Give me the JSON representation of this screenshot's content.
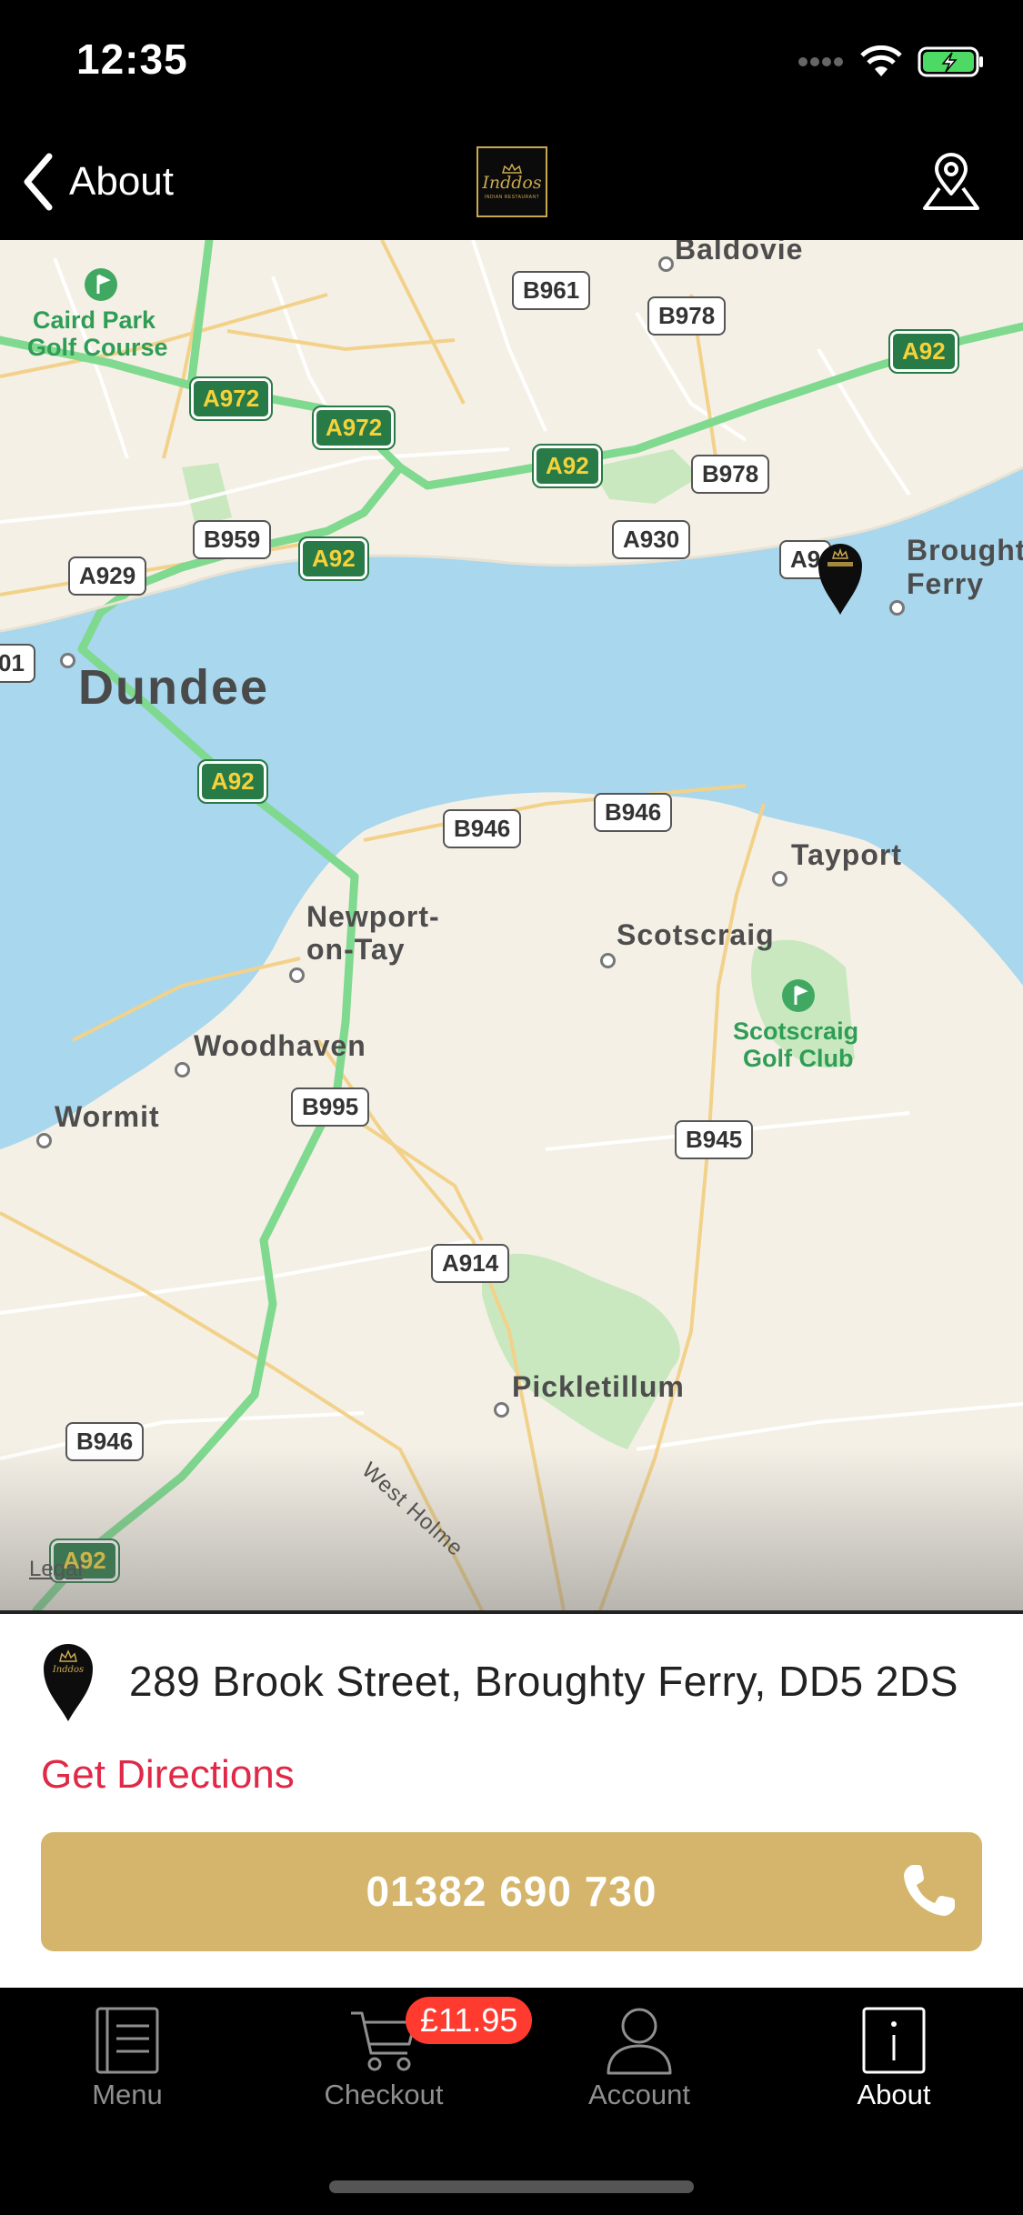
{
  "status_bar": {
    "time": "12:35",
    "icons": [
      "signal-dots-icon",
      "wifi-icon",
      "battery-charging-icon"
    ]
  },
  "nav": {
    "back_label": "About",
    "logo_text": "Inddos",
    "logo_subtitle": "INDIAN RESTAURANT",
    "right_icon": "map-pin-outline-icon"
  },
  "map": {
    "places": {
      "dundee": "Dundee",
      "baldovie": "Baldovie",
      "broughty": "Broughty",
      "ferry": "Ferry",
      "tayport": "Tayport",
      "scotscraig": "Scotscraig",
      "newport_1": "Newport-",
      "newport_2": "on-Tay",
      "woodhaven": "Woodhaven",
      "wormit": "Wormit",
      "pickletillum": "Pickletillum",
      "west_holme": "West Holme"
    },
    "golf": {
      "caird_1": "Caird Park",
      "caird_2": "Golf Course",
      "scotscraig_1": "Scotscraig",
      "scotscraig_2": "Golf Club"
    },
    "roads": {
      "b961": "B961",
      "b978_top": "B978",
      "a92_topright": "A92",
      "a972_left": "A972",
      "a972_right": "A972",
      "a92_mid": "A92",
      "b978_mid": "B978",
      "b959": "B959",
      "a92_left": "A92",
      "a930": "A930",
      "a9_partial": "A9",
      "a929": "A929",
      "partial_01": "01",
      "a92_dundee": "A92",
      "b946_left": "B946",
      "b946_right": "B946",
      "b995": "B995",
      "b945": "B945",
      "a914": "A914",
      "b946_bottom": "B946",
      "a92_bottom": "A92"
    },
    "legal": "Legal"
  },
  "info": {
    "address": "289 Brook Street, Broughty Ferry, DD5 2DS",
    "directions_label": "Get Directions",
    "phone": "01382 690 730"
  },
  "tabs": [
    {
      "label": "Menu",
      "icon": "menu-book-icon",
      "active": false
    },
    {
      "label": "Checkout",
      "icon": "cart-icon",
      "active": false,
      "badge": "£11.95"
    },
    {
      "label": "Account",
      "icon": "person-icon",
      "active": false
    },
    {
      "label": "About",
      "icon": "info-icon",
      "active": true
    }
  ],
  "colors": {
    "accent_gold": "#d4b56b",
    "directions_red": "#e02847",
    "badge_red": "#ff3b30",
    "water": "#a8d7ee",
    "land": "#f5f0e6",
    "a_road_green": "#7fd98f"
  }
}
